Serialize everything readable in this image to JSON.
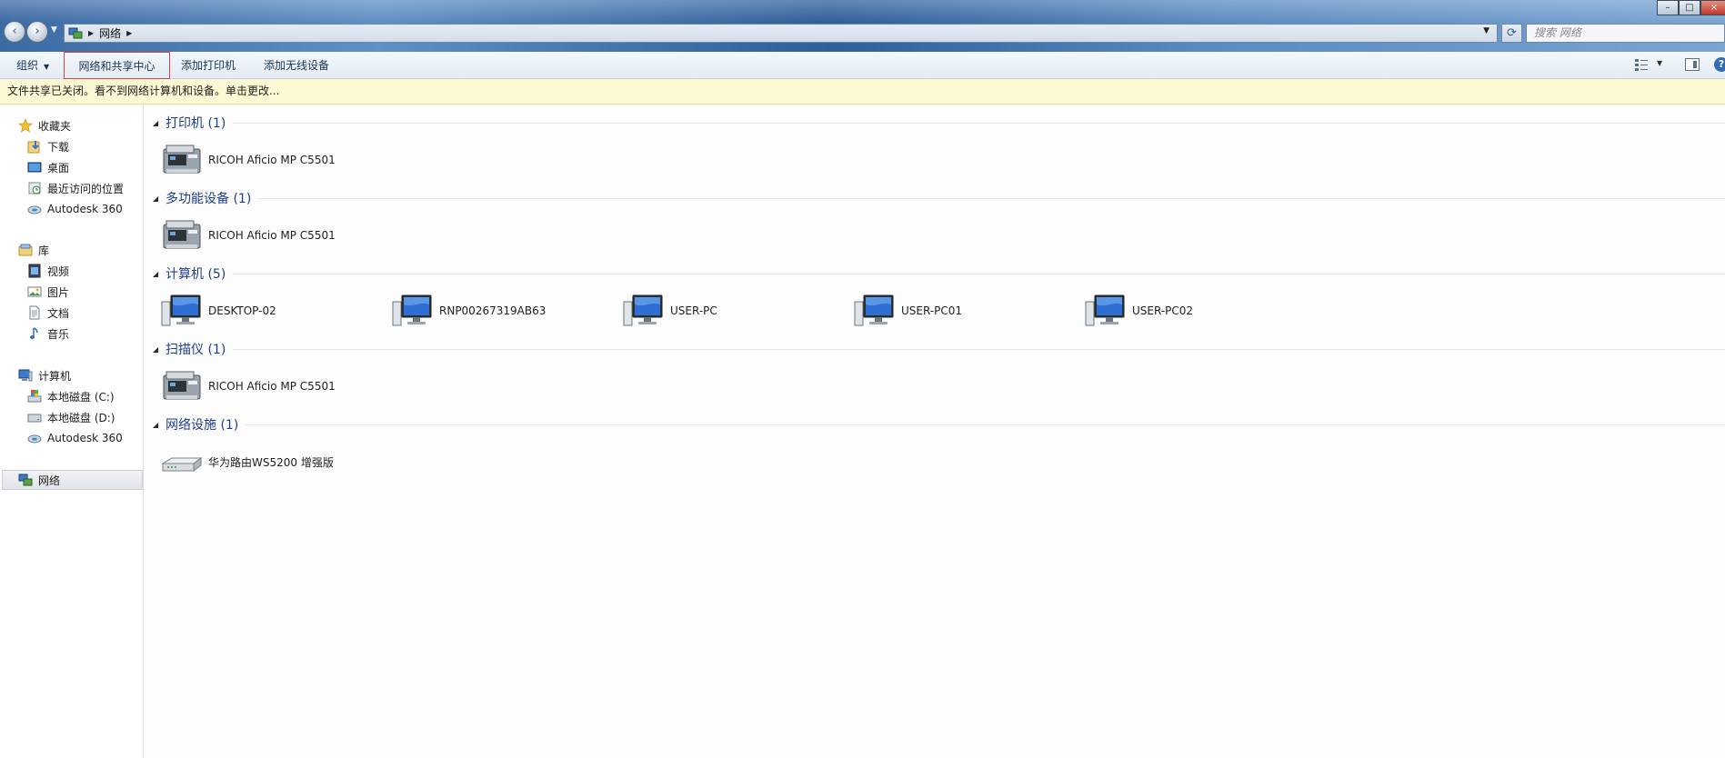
{
  "address": {
    "breadcrumb": [
      "网络"
    ],
    "search_placeholder": "搜索 网络"
  },
  "window_controls": {
    "minimize": "–",
    "maximize": "□",
    "close": "×"
  },
  "toolbar": {
    "organize": "组织",
    "network_center": "网络和共享中心",
    "add_printer": "添加打印机",
    "add_wireless": "添加无线设备"
  },
  "infobar": {
    "message": "文件共享已关闭。看不到网络计算机和设备。单击更改..."
  },
  "sidebar": {
    "favorites": {
      "label": "收藏夹",
      "items": [
        "下载",
        "桌面",
        "最近访问的位置",
        "Autodesk 360"
      ]
    },
    "libraries": {
      "label": "库",
      "items": [
        "视频",
        "图片",
        "文档",
        "音乐"
      ]
    },
    "computer": {
      "label": "计算机",
      "items": [
        "本地磁盘 (C:)",
        "本地磁盘 (D:)",
        "Autodesk 360"
      ]
    },
    "network": {
      "label": "网络"
    }
  },
  "groups": [
    {
      "title": "打印机 (1)",
      "devices": [
        {
          "name": "RICOH Aficio MP C5501",
          "icon": "printer-icon"
        }
      ]
    },
    {
      "title": "多功能设备 (1)",
      "devices": [
        {
          "name": "RICOH Aficio MP C5501",
          "icon": "printer-icon"
        }
      ]
    },
    {
      "title": "计算机 (5)",
      "devices": [
        {
          "name": "DESKTOP-02",
          "icon": "computer-icon"
        },
        {
          "name": "RNP00267319AB63",
          "icon": "computer-icon"
        },
        {
          "name": "USER-PC",
          "icon": "computer-icon"
        },
        {
          "name": "USER-PC01",
          "icon": "computer-icon"
        },
        {
          "name": "USER-PC02",
          "icon": "computer-icon"
        }
      ]
    },
    {
      "title": "扫描仪 (1)",
      "devices": [
        {
          "name": "RICOH Aficio MP C5501",
          "icon": "printer-icon"
        }
      ]
    },
    {
      "title": "网络设施 (1)",
      "devices": [
        {
          "name": "华为路由WS5200 增强版",
          "icon": "router-icon"
        }
      ]
    }
  ],
  "colors": {
    "accent": "#1e3d8a",
    "infobar_bg": "#fdf8d4",
    "highlight_border": "#d0464b"
  }
}
